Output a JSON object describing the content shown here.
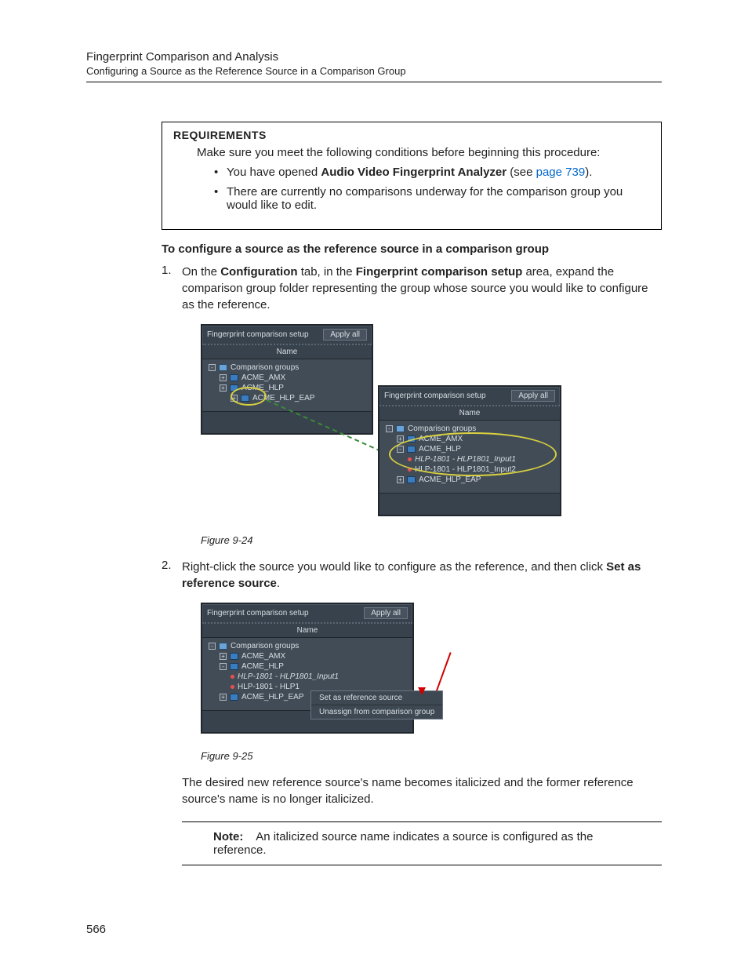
{
  "header": {
    "title": "Fingerprint Comparison and Analysis",
    "subtitle": "Configuring a Source as the Reference Source in a Comparison Group"
  },
  "requirements": {
    "heading": "REQUIREMENTS",
    "intro": "Make sure you meet the following conditions before beginning this procedure:",
    "item1_pre": "You have opened ",
    "item1_bold": "Audio Video Fingerprint Analyzer",
    "item1_mid": " (see ",
    "item1_link": "page 739",
    "item1_post": ").",
    "item2": "There are currently no comparisons underway for the comparison group you would like to edit."
  },
  "section_head": "To configure a source as the reference source in a comparison group",
  "step1": {
    "num": "1.",
    "p1_a": "On the ",
    "p1_b": "Configuration",
    "p1_c": " tab, in the ",
    "p1_d": "Fingerprint comparison setup",
    "p1_e": " area, expand the comparison group folder representing the group whose source you would like to configure as the reference."
  },
  "fig1": {
    "caption": "Figure 9-24",
    "panel_title": "Fingerprint comparison setup",
    "apply": "Apply all",
    "col": "Name",
    "root": "Comparison groups",
    "g1": "ACME_AMX",
    "g2": "ACME_HLP",
    "g3": "ACME_HLP_EAP",
    "src1": "HLP-1801 - HLP1801_Input1",
    "src2": "HLP-1801 - HLP1801_Input2"
  },
  "step2": {
    "num": "2.",
    "p1_a": "Right-click the source you would like to configure as the reference, and then click ",
    "p1_b": "Set as reference source",
    "p1_c": "."
  },
  "fig2": {
    "caption": "Figure 9-25",
    "ctx1": "Set as reference source",
    "ctx2": "Unassign from comparison group",
    "src2short": "HLP-1801 - HLP1"
  },
  "after2": "The desired new reference source's name becomes italicized and the former reference source's name is no longer italicized.",
  "note": {
    "label": "Note:",
    "text": "An italicized source name indicates a source is configured as the reference."
  },
  "page_number": "566"
}
